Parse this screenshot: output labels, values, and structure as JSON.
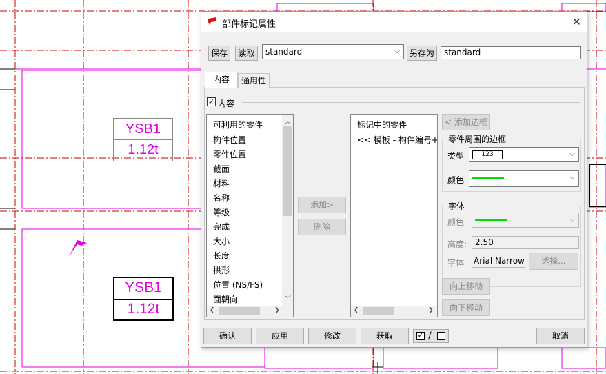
{
  "canvas": {
    "marks": [
      {
        "name": "YSB1",
        "weight": "1.12t"
      },
      {
        "name": "YSB1",
        "weight": "1.12t"
      }
    ],
    "colors": {
      "grid": "#cc0000",
      "part": "#e000e0",
      "border": "#000000"
    }
  },
  "dialog": {
    "title": "部件标记属性",
    "toolbar": {
      "save_label": "保存",
      "load_label": "读取",
      "preset_value": "standard",
      "save_as_label": "另存为",
      "save_as_value": "standard"
    },
    "tabs": [
      "内容",
      "通用性"
    ],
    "content": {
      "checkbox_label": "内容",
      "available_header": "可利用的零件",
      "available_items": [
        "构件位置",
        "零件位置",
        "截面",
        "材料",
        "名称",
        "等级",
        "完成",
        "大小",
        "长度",
        "拱形",
        "位置 (NS/FS)",
        "面朝向"
      ],
      "add_label": "添加>",
      "remove_label": "删除",
      "in_mark_header": "标记中的零件",
      "in_mark_items": [
        "<< 模板 - 构件编号+"
      ],
      "add_frame_label": "< 添加边框",
      "frame_group": {
        "title": "零件周围的边框",
        "type_label": "类型",
        "type_value": "123",
        "color_label": "颜色",
        "color": "#00dd00"
      },
      "font_group": {
        "title": "字体",
        "color_label": "颜色",
        "color": "#00dd00",
        "height_label": "高度:",
        "height_value": "2.50",
        "font_label": "字体",
        "font_value": "Arial Narrow",
        "select_label": "选择..."
      },
      "move_up_label": "向上移动",
      "move_down_label": "向下移动"
    },
    "footer": {
      "ok_label": "确认",
      "apply_label": "应用",
      "modify_label": "修改",
      "get_label": "获取",
      "toggle_sep": "/",
      "cancel_label": "取消"
    }
  }
}
